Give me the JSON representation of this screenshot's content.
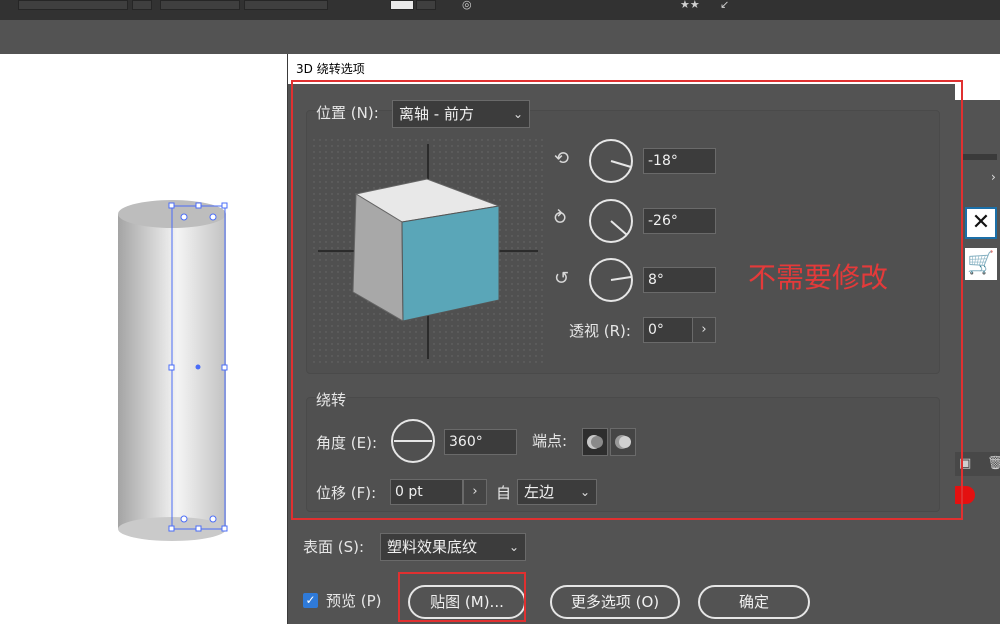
{
  "dialog": {
    "title": "3D 绕转选项",
    "position": {
      "label": "位置 (N):",
      "value": "离轴 - 前方",
      "rotations": [
        {
          "axis_icon": "rotate-x-icon",
          "value": "-18°"
        },
        {
          "axis_icon": "rotate-y-icon",
          "value": "-26°"
        },
        {
          "axis_icon": "rotate-z-icon",
          "value": "8°"
        }
      ],
      "perspective_label": "透视 (R):",
      "perspective_value": "0°"
    },
    "revolve": {
      "group_label": "绕转",
      "angle_label": "角度 (E):",
      "angle_value": "360°",
      "cap_label": "端点:",
      "offset_label": "位移 (F):",
      "offset_value": "0 pt",
      "from_label": "自",
      "from_value": "左边"
    },
    "surface": {
      "label": "表面 (S):",
      "value": "塑料效果底纹"
    },
    "footer": {
      "preview_label": "预览 (P)",
      "preview_checked": true,
      "map_button": "贴图 (M)...",
      "more_options_button": "更多选项 (O)",
      "ok_button": "确定"
    }
  },
  "annotation": {
    "text": "不需要修改",
    "color": "#e43a3a"
  },
  "colors": {
    "cube_front": "#5aa6b8",
    "cube_top": "#e8e8e8",
    "cube_left": "#a8a8a8",
    "selection": "#4a6cf7"
  }
}
